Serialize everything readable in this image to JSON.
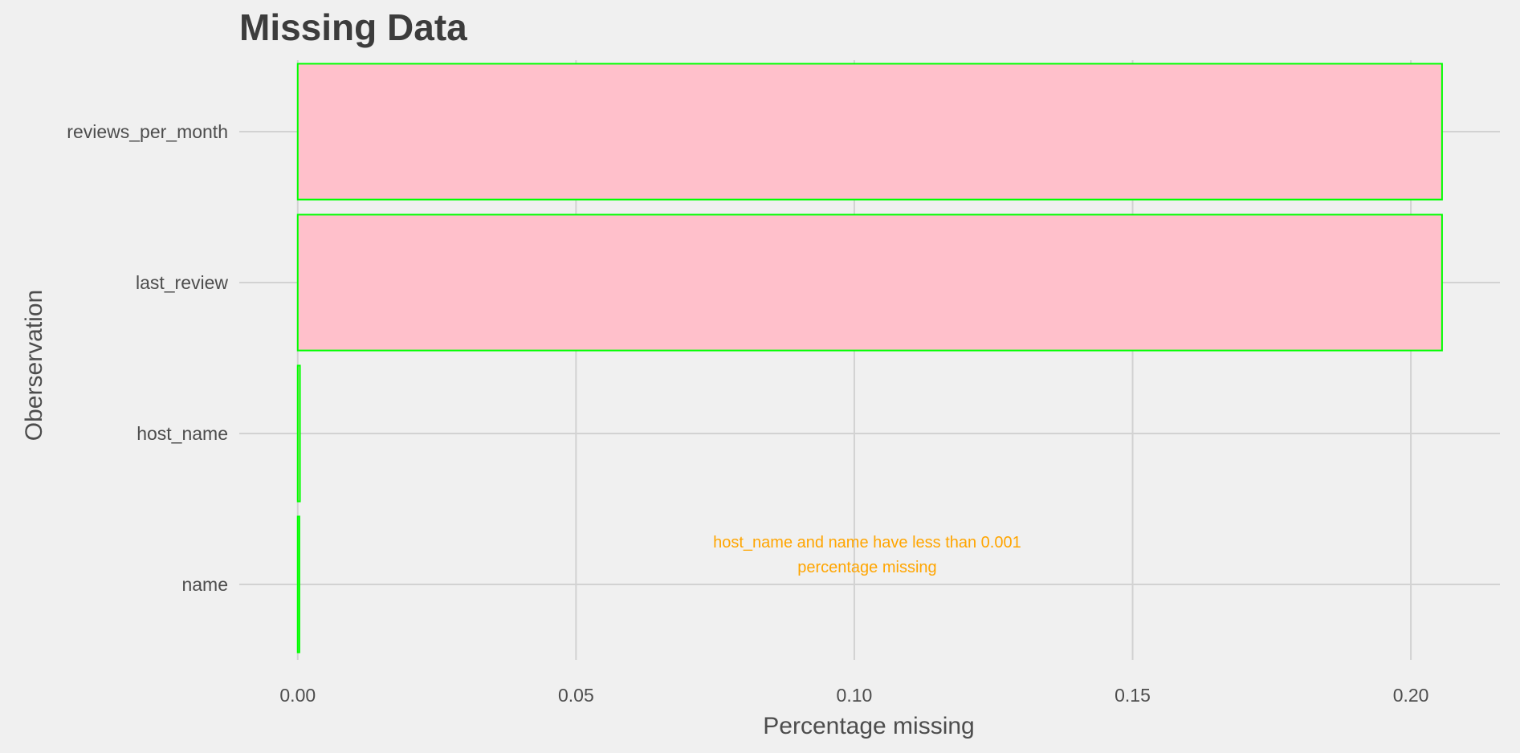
{
  "chart_data": {
    "type": "bar",
    "orientation": "horizontal",
    "title": "Missing Data",
    "xlabel": "Percentage missing",
    "ylabel": "Oberservation",
    "categories": [
      "reviews_per_month",
      "last_review",
      "host_name",
      "name"
    ],
    "values": [
      0.2056,
      0.2056,
      0.0004,
      0.0003
    ],
    "xlim": [
      -0.0105,
      0.216
    ],
    "xticks": [
      0.0,
      0.05,
      0.1,
      0.15,
      0.2
    ],
    "xtick_labels": [
      "0.00",
      "0.05",
      "0.10",
      "0.15",
      "0.20"
    ],
    "grid": true,
    "legend": "none",
    "bar_fill": "#ffc0cb",
    "bar_stroke": "#00ff00",
    "annotation": {
      "lines": [
        "host_name and name have less than 0.001",
        "percentage missing"
      ],
      "x": 0.1,
      "y_position_between": [
        "host_name",
        "name"
      ],
      "color": "#ffa500"
    }
  }
}
